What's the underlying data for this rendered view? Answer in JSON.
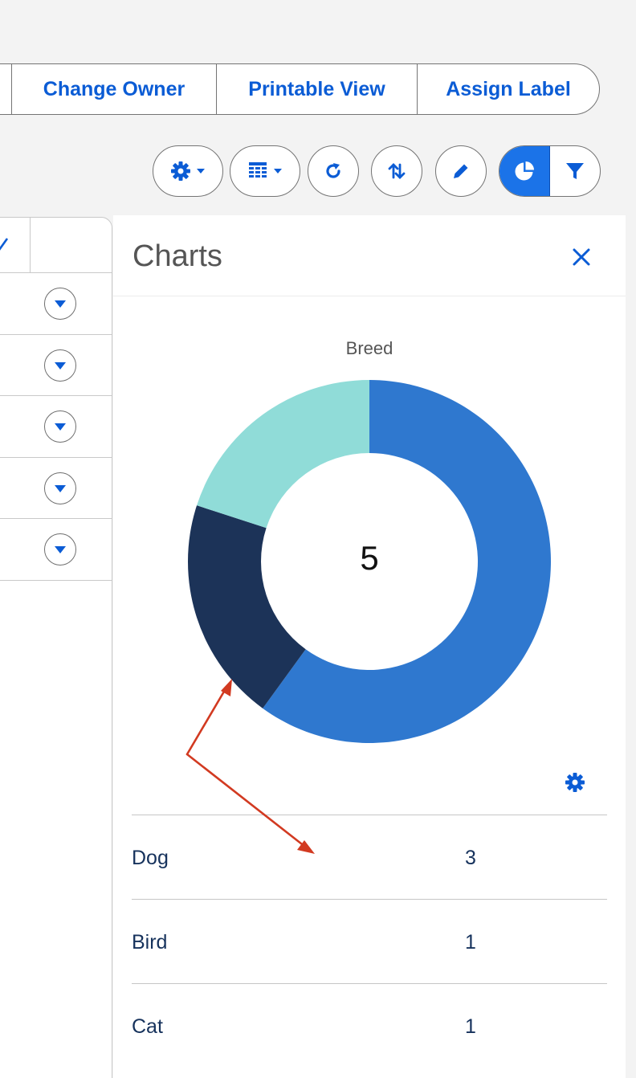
{
  "actions": {
    "change_owner": "Change Owner",
    "printable_view": "Printable View",
    "assign_label": "Assign Label"
  },
  "toolbar": {
    "icons": [
      "gear-icon",
      "table-columns-icon",
      "refresh-icon",
      "sort-icon",
      "pencil-icon",
      "pie-chart-icon",
      "filter-icon"
    ],
    "active": "pie-chart-icon",
    "accent": "#1b73e8"
  },
  "charts": {
    "panel_title": "Charts",
    "center_total": "5"
  },
  "chart_data": {
    "type": "pie",
    "title": "Breed",
    "categories": [
      "Dog",
      "Bird",
      "Cat"
    ],
    "values": [
      3,
      1,
      1
    ],
    "colors": [
      "#2f78cf",
      "#1c3358",
      "#90dcd8"
    ],
    "donut": true
  },
  "legend": [
    {
      "label": "Dog",
      "value": "3"
    },
    {
      "label": "Bird",
      "value": "1"
    },
    {
      "label": "Cat",
      "value": "1"
    }
  ],
  "colors": {
    "link_blue": "#0b5cd5",
    "annotation_arrow": "#d23a21"
  }
}
